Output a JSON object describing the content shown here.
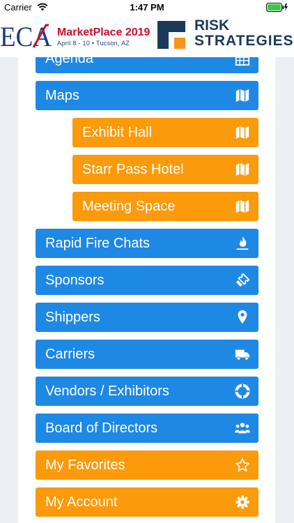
{
  "status": {
    "carrier": "Carrier",
    "time": "1:47 PM"
  },
  "header": {
    "eca_logo": "ECA",
    "eca_title": "MarketPlace 2019",
    "eca_subtitle": "April 8 - 10 • Tucson, AZ",
    "rs_line1": "RISK",
    "rs_line2": "STRATEGIES"
  },
  "colors": {
    "blue": "#1e88e5",
    "orange": "#fb9a0a",
    "background": "#ecf0f5"
  },
  "menu": [
    {
      "label": "Agenda",
      "icon": "calendar-icon",
      "color": "blue"
    },
    {
      "label": "Maps",
      "icon": "map-icon",
      "color": "blue"
    },
    {
      "label": "Exhibit Hall",
      "icon": "map-icon",
      "color": "orange"
    },
    {
      "label": "Starr Pass Hotel",
      "icon": "map-icon",
      "color": "orange"
    },
    {
      "label": "Meeting Space",
      "icon": "map-icon",
      "color": "orange"
    },
    {
      "label": "Rapid Fire Chats",
      "icon": "fire-icon",
      "color": "blue"
    },
    {
      "label": "Sponsors",
      "icon": "ticket-icon",
      "color": "blue"
    },
    {
      "label": "Shippers",
      "icon": "map-marker-icon",
      "color": "blue"
    },
    {
      "label": "Carriers",
      "icon": "truck-icon",
      "color": "blue"
    },
    {
      "label": "Vendors / Exhibitors",
      "icon": "life-ring-icon",
      "color": "blue"
    },
    {
      "label": "Board of Directors",
      "icon": "users-icon",
      "color": "blue"
    },
    {
      "label": "My Favorites",
      "icon": "star-icon",
      "color": "orange"
    },
    {
      "label": "My Account",
      "icon": "gear-icon",
      "color": "orange"
    }
  ]
}
